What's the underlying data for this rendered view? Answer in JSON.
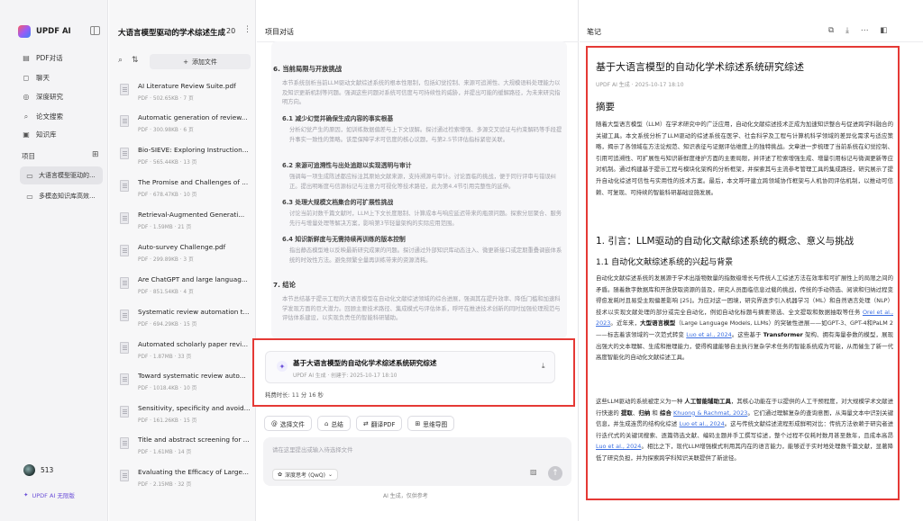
{
  "nav": {
    "app_name": "UPDF AI",
    "items": [
      {
        "label": "PDF对话",
        "icon": "pdf-chat-icon"
      },
      {
        "label": "聊天",
        "icon": "chat-icon"
      },
      {
        "label": "深度研究",
        "icon": "deep-research-icon"
      },
      {
        "label": "论文搜索",
        "icon": "paper-search-icon"
      },
      {
        "label": "知识库",
        "icon": "knowledge-base-icon"
      }
    ],
    "projects_label": "项目",
    "projects": [
      {
        "label": "大语言模型驱动的..."
      },
      {
        "label": "多模态知识库高效..."
      }
    ],
    "user_name": "513",
    "upgrade_label": "UPDF AI 无限版"
  },
  "doclist": {
    "title": "大语言模型驱动的学术综述生成",
    "count": "20",
    "add_label": "添加文件",
    "docs": [
      {
        "title": "AI Literature Review Suite.pdf",
        "meta": "PDF · 502.65KB · 7 页"
      },
      {
        "title": "Automatic generation of review...",
        "meta": "PDF · 300.98KB · 6 页"
      },
      {
        "title": "Bio-SIEVE: Exploring Instruction...",
        "meta": "PDF · 565.44KB · 13 页"
      },
      {
        "title": "The Promise and Challenges of ...",
        "meta": "PDF · 678.47KB · 10 页"
      },
      {
        "title": "Retrieval-Augmented Generati...",
        "meta": "PDF · 1.59MB · 21 页"
      },
      {
        "title": "Auto-survey Challenge.pdf",
        "meta": "PDF · 299.89KB · 3 页"
      },
      {
        "title": "Are ChatGPT and large languag...",
        "meta": "PDF · 851.54KB · 4 页"
      },
      {
        "title": "Systematic review automation t...",
        "meta": "PDF · 694.29KB · 15 页"
      },
      {
        "title": "Automated scholarly paper revi...",
        "meta": "PDF · 1.87MB · 33 页"
      },
      {
        "title": "Toward systematic review auto...",
        "meta": "PDF · 1018.4KB · 10 页"
      },
      {
        "title": "Sensitivity, specificity and avoid...",
        "meta": "PDF · 161.26KB · 15 页"
      },
      {
        "title": "Title and abstract screening for ...",
        "meta": "PDF · 1.61MB · 14 页"
      },
      {
        "title": "Evaluating the Efficacy of Large...",
        "meta": "PDF · 2.15MB · 32 页"
      }
    ]
  },
  "chat": {
    "header": "项目对话",
    "section6_title": "6. 当前局限与开放挑战",
    "section6_intro": "本节系统剖析当前LLM驱动文献综述系统的根本性限制，包括幻觉控制、来源可追溯性、大规模语料处理能力以及知识更新机制等问题。强调这些问题对系统可信度与可持续性的威胁，并提出可能的缓解路径，为未来研究指明方向。",
    "s61_title": "6.1 减少幻觉并确保生成内容的事实根基",
    "s61_text": "分析幻觉产生的原因，如训练数据偏差与上下文误解。探讨通过检索增强、多源交叉验证与约束解码等手段提升事实一致性的策略。该是保障学术可信度的核心议题，与第2.5节评估指标紧密关联。",
    "s62_title": "6.2 来源可追溯性与出处追踪以实现透明与审计",
    "s62_text": "强调每一项生成陈述都应标注其原始文献来源，支持溯源与审计。讨论面临的挑战，便于同行评审与错误纠正。提出明晰度与信源标记与注意力可视化等技术路径，此为第4.4节引用完整性的延伸。",
    "s63_title": "6.3 处理大规模文档集合的可扩展性挑战",
    "s63_text": "讨论当前对数千篇文献时，LLM上下文长度限制、计算成本与响应延迟带来的瓶颈问题。探索分层聚合、服务先行与增量处理等解决方案，影响第3节轻量架构的实际应用范围。",
    "s64_title": "6.4 知识新鲜度与无需持续再训练的版本控制",
    "s64_text": "指出静态模型难以反映最新研究成果的问题。探讨通过外部知识库动态注入、微更新接口或定期重叠调嵌体系统的时效性方法。避免频繁全量再训练带来的资源消耗。",
    "s7_title": "7. 结论",
    "s7_text": "本节总结基于提示工程的大语言模型在自动化文献综述领域的综合进展，强调其在提升效率、降低门槛和加速科学发现方面的巨大潜力。回顾主要技术路径、集成模式与评估体系，呼吁在推进技术创新的同时加强伦理规范与评估体系建设，以实现负责任的智能科研辅助。",
    "summary_card": {
      "title": "基于大语言模型的自动化学术综述系统研究综述",
      "meta": "UPDF AI 生成 · 创建于: 2025-10-17 18:10",
      "time_label": "耗费时长: 11 分 16 秒"
    },
    "chips": [
      {
        "label": "选择文件",
        "icon": "attach-icon"
      },
      {
        "label": "总结",
        "icon": "summary-icon"
      },
      {
        "label": "翻译PDF",
        "icon": "translate-icon"
      },
      {
        "label": "思维导图",
        "icon": "mindmap-icon"
      }
    ],
    "input_placeholder": "请在这里提出或输入待选择文件",
    "model_label": "深度思考 (QwQ)",
    "ai_note": "AI 生成，仅供参考"
  },
  "notes": {
    "header": "笔记",
    "title": "基于大语言模型的自动化学术综述系统研究综述",
    "meta": "UPDF AI 生成 · 2025-10-17 18:10",
    "abstract_heading": "摘要",
    "abstract_text": "随着大型语言模型（LLM）在学术研究中的广泛应用，自动化文献综述技术正成为加速知识整合与促进跨学科融合的关键工具。本文系统分析了LLM驱动的综述系统在医学、社会科学及工程与计算机科学领域的差异化需求与适应策略，揭示了各领域在方法论规范、知识表征与证据评估维度上的独特挑战。文章进一步梳理了当前系统在幻觉控制、引用可追溯性、可扩展性与知识新鲜度维护方面的主要局限，并评述了检索增强生成、增量引用标记与微调更新等应对机制。通过构建基于提示工程与模块化架构的分析框架，并探索其与主流参考管理工具的集成路径，研究展示了提升自动化综述可信性与实用性的技术方案。最后，本文呼吁建立跨领域协作框架与人机协同评估机制，以推动可信赖、可复现、可持续的智能科研基础设施发展。",
    "section1_heading": "1. 引言：LLM驱动的自动化文献综述系统的概念、意义与挑战",
    "section11_heading": "1.1 自动化文献综述系统的兴起与背景",
    "p1": {
      "a": "自动化文献综述系统的发展源于学术出版物数量的指数级增长与传统人工综述方法在效率和可扩展性上的局限之间的矛盾。随着数字数据库和开放获取资源的普及，研究人员面临信息过载的挑战，传统的手动筛选、阅读和归纳过程变得愈发耗时且易受主观偏差影响 [25]。为应对这一困境，研究界逐步引入机器学习（ML）和自然语言处理（NLP）技术以实现文献处理的部分或完全自动化，例如自动化标题与摘要筛选、全文提取和数据抽取等任务 ",
      "link1": "Orel et al., 2023",
      "b": "。近年来，",
      "bold1": "大型语言模型",
      "c": "（Large Language Models, LLMs）的突破性进展——如GPT-3、GPT-4和PaLM 2——标志着该领域的一次范式转变 ",
      "link2": "Luo et al., 2024",
      "d": "。这些基于 ",
      "bold2": "Transformer",
      "e": " 架构、拥有海量参数的模型，展现出强大的文本理解、生成和推理能力，使得构建能够自主执行复杂学术任务的智能系统成为可能，从而催生了新一代高度智能化的自动化文献综述工具。"
    },
    "p2": {
      "a": "这些LLM驱动的系统被定义为一种 ",
      "bold1": "人工智能辅助工具",
      "b": "，其核心功能在于以提供的人工干预程度，对大规模学术文献进行快速的 ",
      "bold2": "提取",
      "c": "、",
      "bold3": "归纳",
      "d": " 和 ",
      "bold4": "综合",
      "e": " ",
      "link1": "Khuong & Rachmat, 2023",
      "f": "。它们通过理解复杂的查询意图，从海量文本中识别关键信息，并生成连贯的结构化综述 ",
      "link2": "Luo et al., 2024",
      "g": "。这与传统文献综述流程形成鲜明对比：传统方法依赖于研究者进行迭代式的关键词搜索、逐篇筛选文献、编码主题并手工撰写综述，整个过程不仅耗时数月甚至数年，且成本高昂 ",
      "link3": "Luo et al., 2024",
      "h": "。相比之下，现代LLM增强模式利用其内在的语言能力，能够近于实时地处理数千篇文献，显著降低了研究负担，并为探索跨学科知识关联提供了新途径。"
    }
  }
}
